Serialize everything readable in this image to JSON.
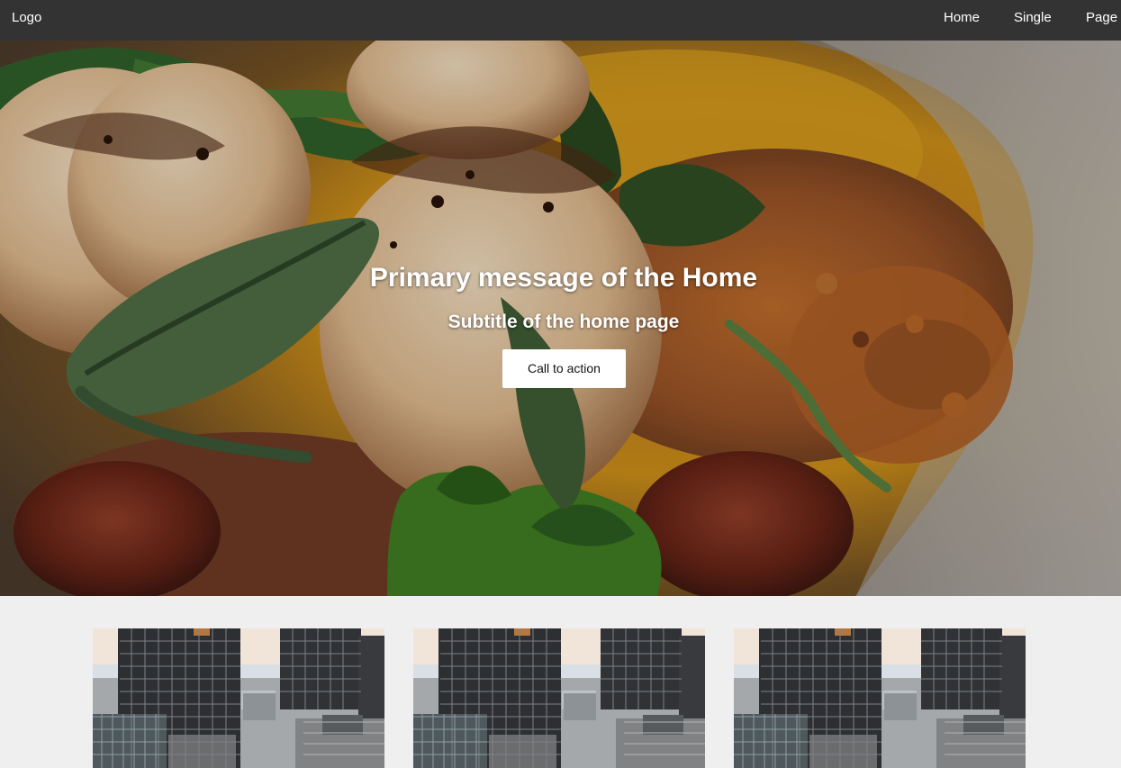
{
  "header": {
    "logo": "Logo",
    "nav": [
      {
        "label": "Home"
      },
      {
        "label": "Single"
      },
      {
        "label": "Page"
      }
    ]
  },
  "hero": {
    "title": "Primary message of the Home",
    "subtitle": "Subtitle of the home page",
    "cta_label": "Call to action",
    "image": "plated-scallops-photo"
  },
  "cards": [
    {
      "image": "city-skyline-photo"
    },
    {
      "image": "city-skyline-photo"
    },
    {
      "image": "city-skyline-photo"
    }
  ],
  "colors": {
    "header_bg": "#333333",
    "page_bg": "#efefef",
    "button_bg": "#ffffff",
    "text_light": "#ffffff"
  }
}
